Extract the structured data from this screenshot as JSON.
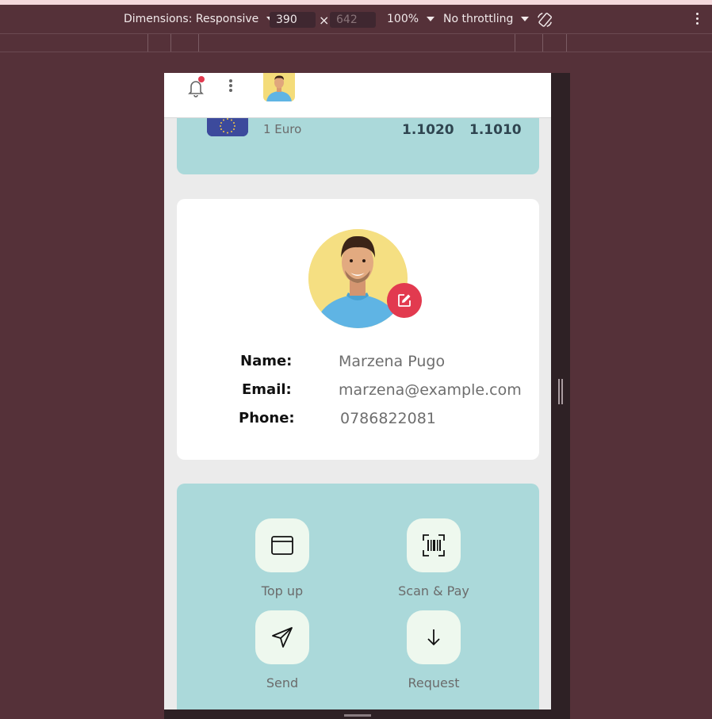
{
  "devtools": {
    "dimensions_label": "Dimensions: Responsive",
    "width": "390",
    "height": "642",
    "zoom": "100%",
    "throttling": "No throttling"
  },
  "rate": {
    "currency_label": "1 Euro",
    "buy": "1.1020",
    "sell": "1.1010"
  },
  "profile": {
    "name_label": "Name:",
    "name_value": "Marzena Pugo",
    "email_label": "Email:",
    "email_value": "marzena@example.com",
    "phone_label": "Phone:",
    "phone_value": "0786822081"
  },
  "actions": {
    "top_up": "Top up",
    "scan_pay": "Scan & Pay",
    "send": "Send",
    "request": "Request"
  },
  "colors": {
    "accent_red": "#e23a4f",
    "teal_card": "#abd9da",
    "devtools_bg": "#553139"
  }
}
